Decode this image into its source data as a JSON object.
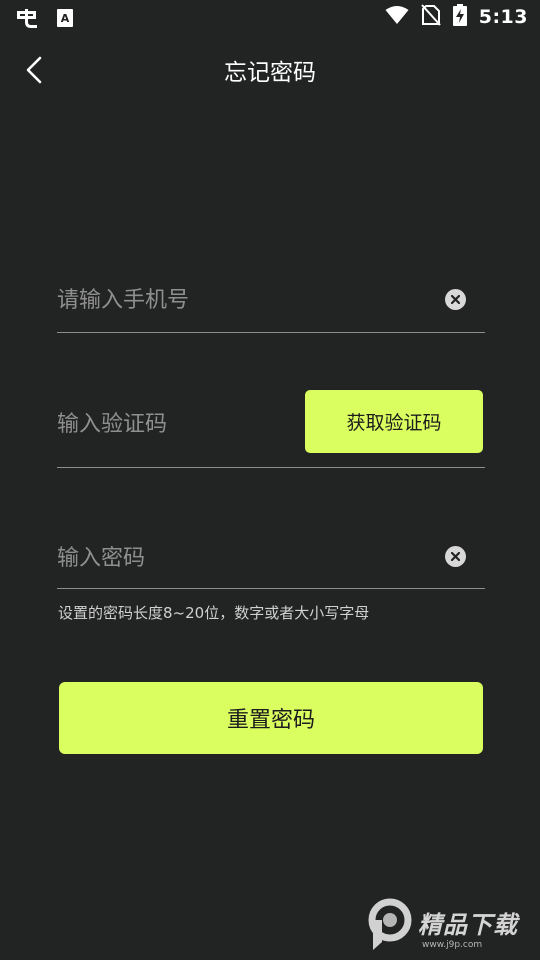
{
  "status_bar": {
    "time": "5:13",
    "icons": [
      "app-logo-icon",
      "accessibility-icon",
      "wifi-icon",
      "no-sim-icon",
      "battery-charging-icon"
    ]
  },
  "header": {
    "back_icon": "back-arrow-icon",
    "title": "忘记密码"
  },
  "form": {
    "phone_placeholder": "请输入手机号",
    "phone_value": "",
    "code_placeholder": "输入验证码",
    "code_value": "",
    "get_code_label": "获取验证码",
    "password_placeholder": "输入密码",
    "password_value": "",
    "password_hint": "设置的密码长度8~20位，数字或者大小写字母",
    "submit_label": "重置密码"
  },
  "watermark": {
    "main": "精品下载",
    "sub": "www.j9p.com"
  },
  "colors": {
    "background": "#222323",
    "accent": "#dafd60",
    "button_text": "#1d1d1d",
    "placeholder": "#8f8f8f",
    "divider": "#8e8e8e"
  }
}
